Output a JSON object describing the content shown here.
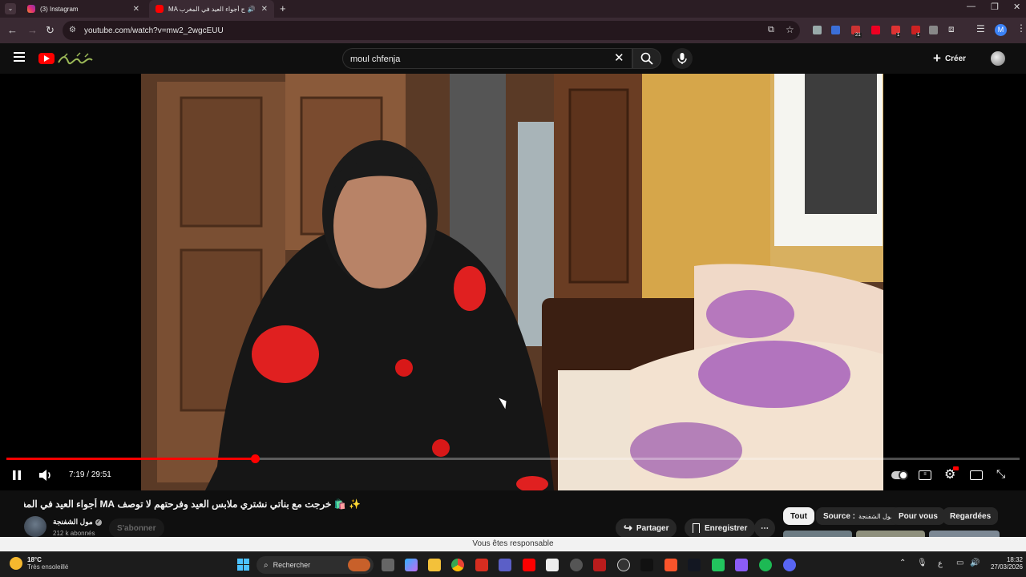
{
  "browser": {
    "tabs": [
      {
        "title": "(3) Instagram",
        "favicon_color": "#d62976"
      },
      {
        "title": "MA ج أجواء العيد في المغرب",
        "favicon_color": "#ff0000",
        "active": true
      }
    ],
    "new_tab": "+",
    "url": "youtube.com/watch?v=mw2_2wgcEUU",
    "profile_initial": "M",
    "ext_badges": [
      "21",
      "1",
      "1"
    ]
  },
  "youtube": {
    "search_value": "moul chfenja",
    "create_label": "Créer"
  },
  "player": {
    "time_current": "7:19",
    "time_separator": "/",
    "time_total": "29:51",
    "progress_fraction": 0.245
  },
  "video": {
    "title": "✨ 🛍️ خرجت مع بناتي نشتري ملابس العيد وفرحتهم لا توصف MA أجواء العيد في المغرب",
    "channel_name": "مول الشفنجة",
    "subscribers": "212 k abonnés",
    "subscribe_label": "S'abonner",
    "share_label": "Partager",
    "save_label": "Enregistrer",
    "more_label": "⋯"
  },
  "filters": {
    "all": "Tout",
    "source_label": "Source :",
    "source_value": "مول الشفنجة",
    "for_you": "Pour vous",
    "watched": "Regardées"
  },
  "notice": "Vous êtes responsable",
  "taskbar": {
    "temperature": "18°C",
    "weather": "Très ensoleillé",
    "search_label": "Rechercher",
    "lang": "ع",
    "time": "18:32",
    "date": "27/03/2026"
  },
  "colors": {
    "accent": "#ff0000",
    "chrome_frame": "#2b1d24",
    "yt_bg": "#0f0f0f"
  }
}
